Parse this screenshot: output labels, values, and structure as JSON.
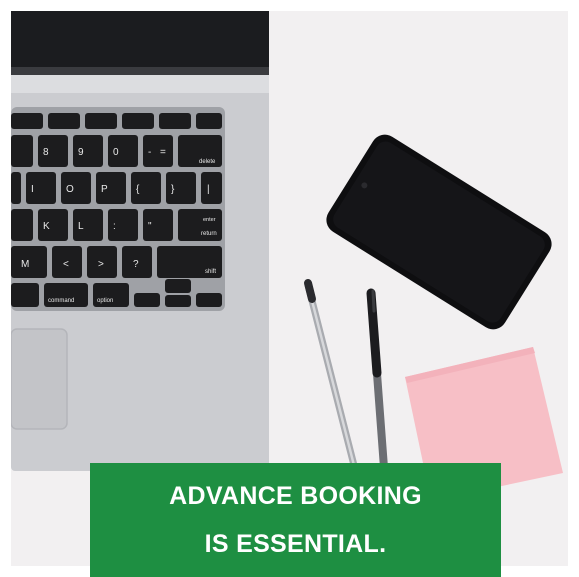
{
  "banner": {
    "line1": "ADVANCE BOOKING",
    "line2": "IS ESSENTIAL."
  },
  "keyboard": {
    "delete": "delete",
    "return": "return",
    "enter": "enter",
    "shift": "shift",
    "command": "command",
    "option": "option",
    "keys_row1": [
      "8",
      "9",
      "0",
      "-",
      "="
    ],
    "keys_row2": [
      "I",
      "O",
      "P",
      "{",
      "}",
      "|"
    ],
    "keys_row3": [
      "K",
      "L",
      ":",
      "\""
    ],
    "keys_row4": [
      "M",
      "<",
      ">",
      "?"
    ]
  },
  "colors": {
    "banner_green": "#1e8f42",
    "background": "#f2f0f1",
    "laptop_silver": "#c8c9cc",
    "key_black": "#1c1c1e",
    "sticky_note": "#f7bfc6",
    "phone": "#0e0e10"
  }
}
